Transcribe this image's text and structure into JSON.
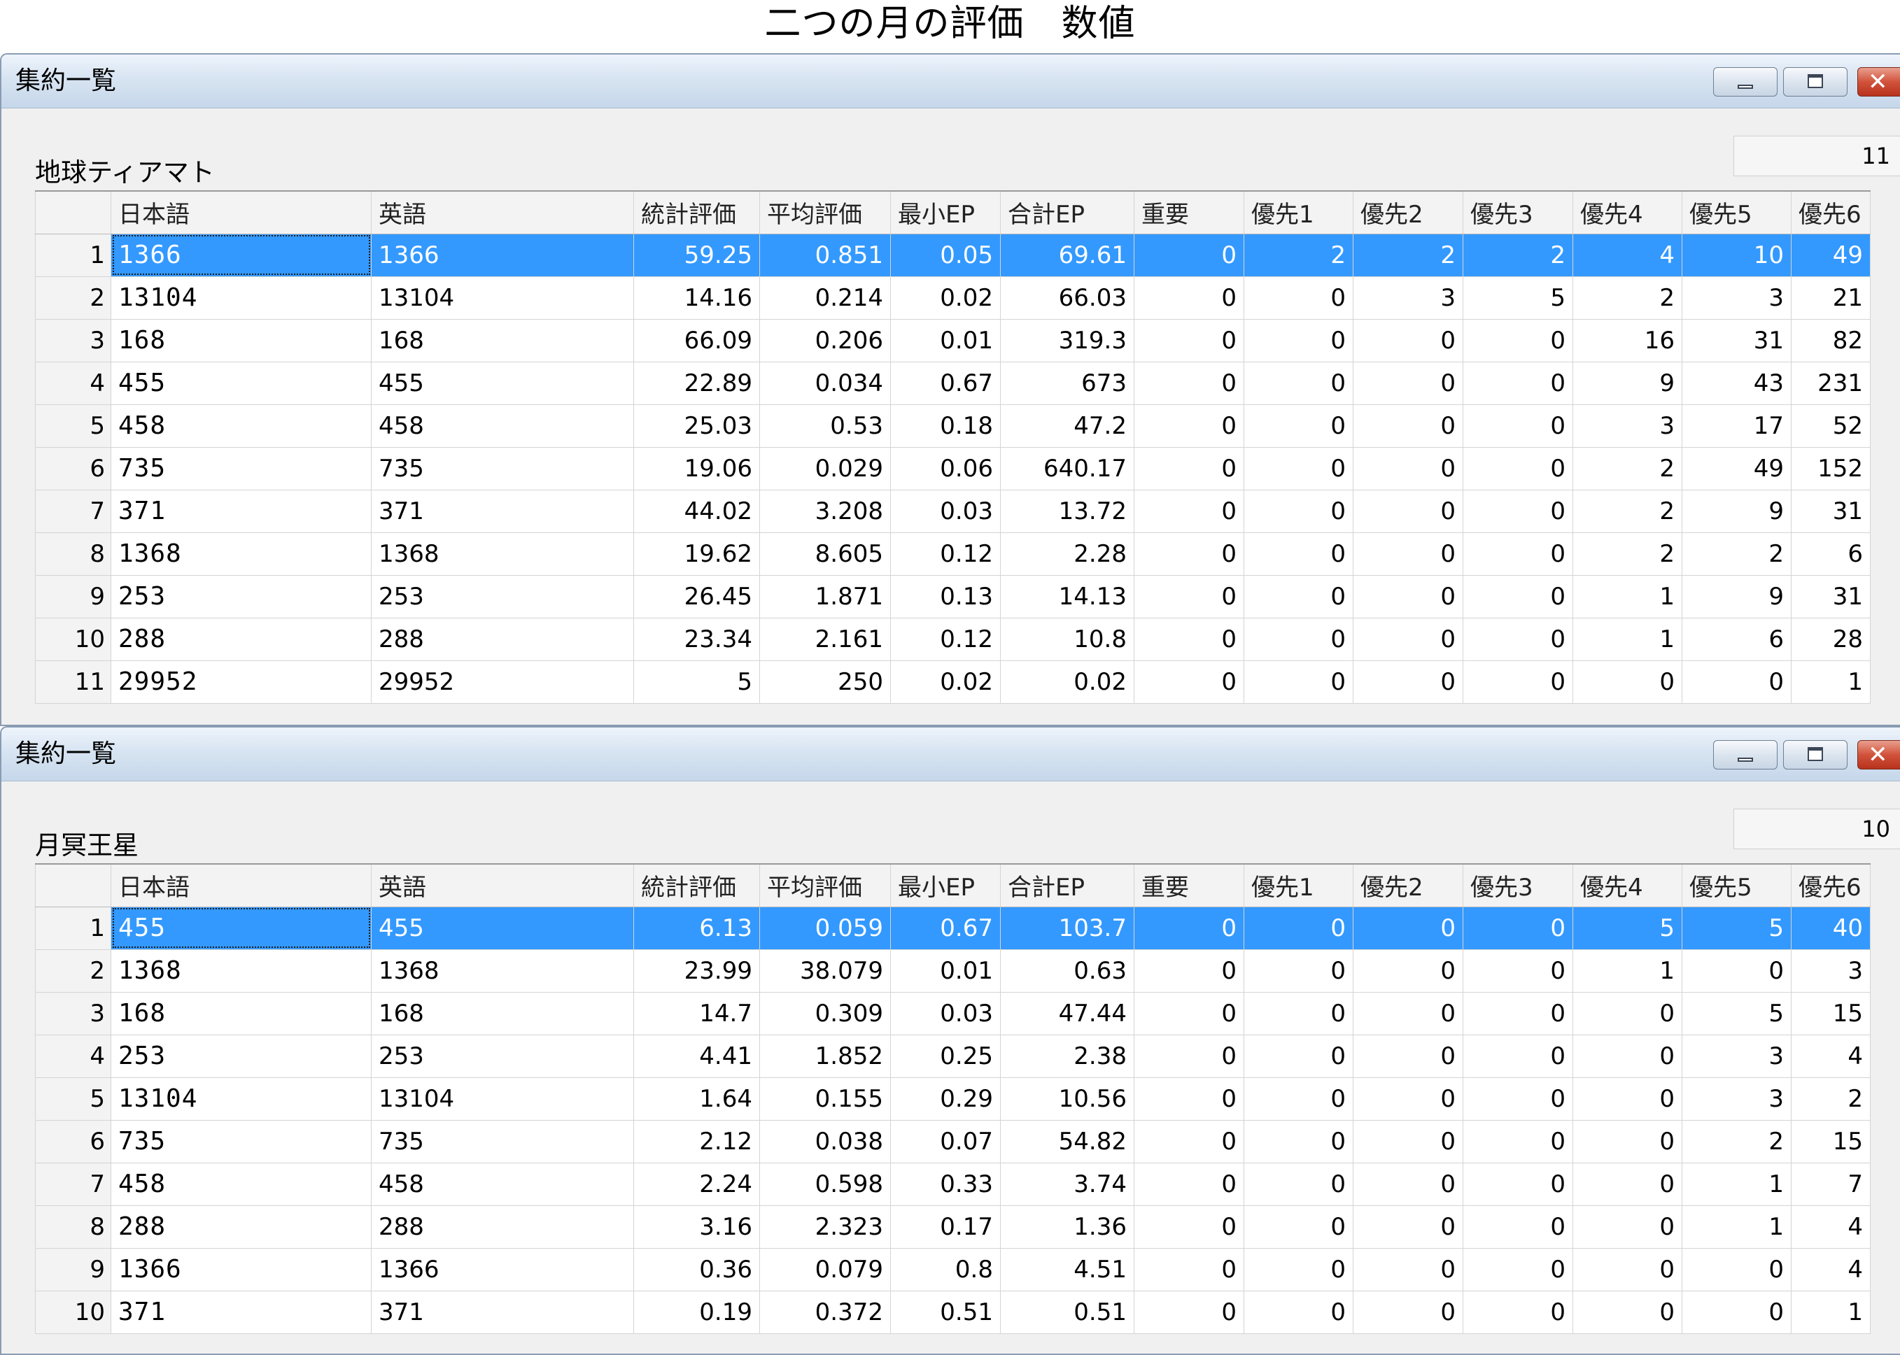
{
  "page_title": "二つの月の評価　数値",
  "columns": [
    "",
    "日本語",
    "英語",
    "統計評価",
    "平均評価",
    "最小EP",
    "合計EP",
    "重要",
    "優先1",
    "優先2",
    "優先3",
    "優先4",
    "優先5",
    "優先6"
  ],
  "windows": [
    {
      "title": "集約一覧",
      "label": "地球ティアマト",
      "count": "11",
      "rows": [
        [
          "1",
          "1366",
          "1366",
          "59.25",
          "0.851",
          "0.05",
          "69.61",
          "0",
          "2",
          "2",
          "2",
          "4",
          "10",
          "49"
        ],
        [
          "2",
          "13104",
          "13104",
          "14.16",
          "0.214",
          "0.02",
          "66.03",
          "0",
          "0",
          "3",
          "5",
          "2",
          "3",
          "21"
        ],
        [
          "3",
          "168",
          "168",
          "66.09",
          "0.206",
          "0.01",
          "319.3",
          "0",
          "0",
          "0",
          "0",
          "16",
          "31",
          "82"
        ],
        [
          "4",
          "455",
          "455",
          "22.89",
          "0.034",
          "0.67",
          "673",
          "0",
          "0",
          "0",
          "0",
          "9",
          "43",
          "231"
        ],
        [
          "5",
          "458",
          "458",
          "25.03",
          "0.53",
          "0.18",
          "47.2",
          "0",
          "0",
          "0",
          "0",
          "3",
          "17",
          "52"
        ],
        [
          "6",
          "735",
          "735",
          "19.06",
          "0.029",
          "0.06",
          "640.17",
          "0",
          "0",
          "0",
          "0",
          "2",
          "49",
          "152"
        ],
        [
          "7",
          "371",
          "371",
          "44.02",
          "3.208",
          "0.03",
          "13.72",
          "0",
          "0",
          "0",
          "0",
          "2",
          "9",
          "31"
        ],
        [
          "8",
          "1368",
          "1368",
          "19.62",
          "8.605",
          "0.12",
          "2.28",
          "0",
          "0",
          "0",
          "0",
          "2",
          "2",
          "6"
        ],
        [
          "9",
          "253",
          "253",
          "26.45",
          "1.871",
          "0.13",
          "14.13",
          "0",
          "0",
          "0",
          "0",
          "1",
          "9",
          "31"
        ],
        [
          "10",
          "288",
          "288",
          "23.34",
          "2.161",
          "0.12",
          "10.8",
          "0",
          "0",
          "0",
          "0",
          "1",
          "6",
          "28"
        ],
        [
          "11",
          "29952",
          "29952",
          "5",
          "250",
          "0.02",
          "0.02",
          "0",
          "0",
          "0",
          "0",
          "0",
          "0",
          "1"
        ]
      ]
    },
    {
      "title": "集約一覧",
      "label": "月冥王星",
      "count": "10",
      "rows": [
        [
          "1",
          "455",
          "455",
          "6.13",
          "0.059",
          "0.67",
          "103.7",
          "0",
          "0",
          "0",
          "0",
          "5",
          "5",
          "40"
        ],
        [
          "2",
          "1368",
          "1368",
          "23.99",
          "38.079",
          "0.01",
          "0.63",
          "0",
          "0",
          "0",
          "0",
          "1",
          "0",
          "3"
        ],
        [
          "3",
          "168",
          "168",
          "14.7",
          "0.309",
          "0.03",
          "47.44",
          "0",
          "0",
          "0",
          "0",
          "0",
          "5",
          "15"
        ],
        [
          "4",
          "253",
          "253",
          "4.41",
          "1.852",
          "0.25",
          "2.38",
          "0",
          "0",
          "0",
          "0",
          "0",
          "3",
          "4"
        ],
        [
          "5",
          "13104",
          "13104",
          "1.64",
          "0.155",
          "0.29",
          "10.56",
          "0",
          "0",
          "0",
          "0",
          "0",
          "3",
          "2"
        ],
        [
          "6",
          "735",
          "735",
          "2.12",
          "0.038",
          "0.07",
          "54.82",
          "0",
          "0",
          "0",
          "0",
          "0",
          "2",
          "15"
        ],
        [
          "7",
          "458",
          "458",
          "2.24",
          "0.598",
          "0.33",
          "3.74",
          "0",
          "0",
          "0",
          "0",
          "0",
          "1",
          "7"
        ],
        [
          "8",
          "288",
          "288",
          "3.16",
          "2.323",
          "0.17",
          "1.36",
          "0",
          "0",
          "0",
          "0",
          "0",
          "1",
          "4"
        ],
        [
          "9",
          "1366",
          "1366",
          "0.36",
          "0.079",
          "0.8",
          "4.51",
          "0",
          "0",
          "0",
          "0",
          "0",
          "0",
          "4"
        ],
        [
          "10",
          "371",
          "371",
          "0.19",
          "0.372",
          "0.51",
          "0.51",
          "0",
          "0",
          "0",
          "0",
          "0",
          "0",
          "1"
        ]
      ]
    }
  ],
  "selected_row": 1,
  "colors": {
    "selection": "#3399ff",
    "titlebar": "#c6d7ea",
    "close_button": "#d1523b"
  },
  "icons": {
    "minimize": "minimize-icon",
    "maximize": "maximize-icon",
    "close": "close-icon"
  }
}
